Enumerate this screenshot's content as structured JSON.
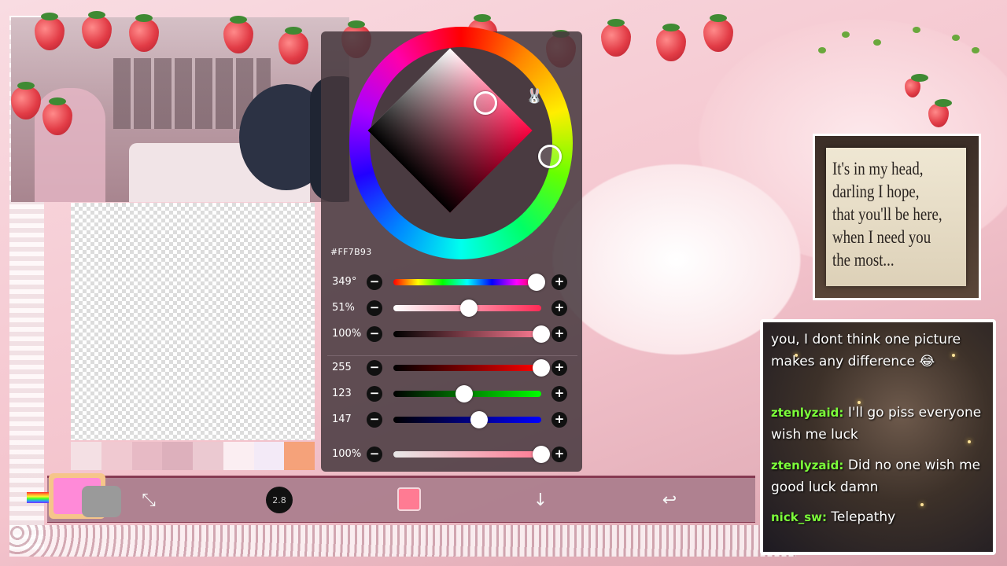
{
  "color_picker": {
    "hex": "#FF7B93",
    "hsv_sliders": [
      {
        "label": "349°",
        "fraction": 0.97
      },
      {
        "label": "51%",
        "fraction": 0.51
      },
      {
        "label": "100%",
        "fraction": 1.0
      }
    ],
    "rgb_sliders": [
      {
        "label": "255",
        "fraction": 1.0
      },
      {
        "label": "123",
        "fraction": 0.48
      },
      {
        "label": "147",
        "fraction": 0.58
      }
    ],
    "opacity_slider": {
      "label": "100%",
      "fraction": 1.0
    },
    "minus_label": "−",
    "plus_label": "+"
  },
  "toolbar": {
    "brush_size": "2.8",
    "current_color": "#FF7B93",
    "transform_icon": "transform-icon",
    "download_icon": "arrow-down-icon",
    "undo_icon": "undo-arrow-icon"
  },
  "palette": [
    "#f4e0e4",
    "#f0c9d1",
    "#e7bac5",
    "#ddb0bc",
    "#ebc9d1",
    "#fbeef2",
    "#f3eaf7",
    "#f5a27a"
  ],
  "quote": {
    "lines": [
      "It's in my head,",
      "darling I hope,",
      "that you'll be here,",
      "when I need you",
      "the most..."
    ]
  },
  "chat": {
    "messages": [
      {
        "user": "",
        "text": "you, I dont think one picture makes any difference 😂"
      },
      {
        "user": "ztenlyzaid:",
        "text": "I'll go piss everyone wish me luck"
      },
      {
        "user": "ztenlyzaid:",
        "text": "Did no one wish me good luck damn"
      },
      {
        "user": "nick_sw:",
        "text": "Telepathy"
      }
    ],
    "name_color": "#7cff3a"
  }
}
